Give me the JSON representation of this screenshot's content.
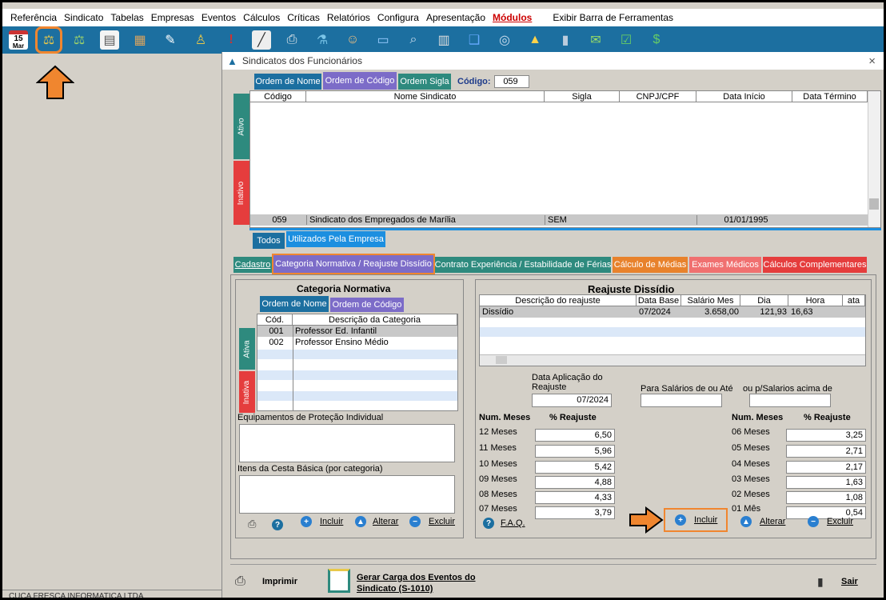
{
  "menu": [
    "Referência",
    "Sindicato",
    "Tabelas",
    "Empresas",
    "Eventos",
    "Cálculos",
    "Críticas",
    "Relatórios",
    "Configura",
    "Apresentação"
  ],
  "menu_modulos": "Módulos",
  "menu_barra": "Exibir Barra de Ferramentas",
  "calendar": {
    "day": "15",
    "month": "Mar"
  },
  "window": {
    "title": "Sindicatos dos Funcionários",
    "close": "×"
  },
  "order_tabs": {
    "nome": "Ordem de Nome",
    "codigo": "Ordem de Código",
    "sigla": "Ordem Sigla",
    "codigo_label": "Código:",
    "codigo_value": "059"
  },
  "sind_table": {
    "headers": [
      "Código",
      "Nome Sindicato",
      "Sigla",
      "CNPJ/CPF",
      "Data Início",
      "Data Término"
    ],
    "rows": [
      {
        "codigo": "059",
        "nome": "Sindicato dos Empregados de Marília",
        "sigla": "SEM",
        "cnpj": "",
        "inicio": "01/01/1995",
        "termino": ""
      }
    ]
  },
  "vtabs": {
    "ativo": "Ativo",
    "inativo": "Inativo"
  },
  "filter_tabs": {
    "todos": "Todos",
    "utilizados": "Utilizados Pela Empresa"
  },
  "main_tabs": [
    "Cadastro",
    "Categoria Normativa / Reajuste Dissídio",
    "Contrato Experiência / Estabilidade de Férias",
    "Cálculo de Médias",
    "Exames Médicos",
    "Cálculos Complementares"
  ],
  "categoria": {
    "title": "Categoria Normativa",
    "order_nome": "Ordem de Nome",
    "order_codigo": "Ordem de Código",
    "headers": [
      "Cód.",
      "Descrição da Categoria"
    ],
    "rows": [
      {
        "cod": "001",
        "desc": "Professor Ed. Infantil"
      },
      {
        "cod": "002",
        "desc": "Professor Ensino Médio"
      }
    ],
    "vtab_ativa": "Ativa",
    "vtab_inativa": "Inativa",
    "epi_label": "Equipamentos de Proteção Individual",
    "cesta_label": "Itens da Cesta Básica (por categoria)",
    "incluir": "Incluir",
    "alterar": "Alterar",
    "excluir": "Excluir"
  },
  "reajuste": {
    "title": "Reajuste Dissídio",
    "headers": [
      "Descrição do reajuste",
      "Data Base",
      "Salário Mes",
      "Dia",
      "Hora",
      "ata"
    ],
    "rows": [
      {
        "desc": "Dissídio",
        "base": "07/2024",
        "salario": "3.658,00",
        "dia": "121,93",
        "hora": "16,63"
      }
    ],
    "data_aplic_label": "Data Aplicação do Reajuste",
    "data_aplic_value": "07/2024",
    "para_salarios_label": "Para Salários de ou Até",
    "acima_label": "ou p/Salarios acima de",
    "num_meses": "Num. Meses",
    "pct_reajuste": "% Reajuste",
    "left": [
      {
        "m": "12 Meses",
        "v": "6,50"
      },
      {
        "m": "11 Meses",
        "v": "5,96"
      },
      {
        "m": "10 Meses",
        "v": "5,42"
      },
      {
        "m": "09 Meses",
        "v": "4,88"
      },
      {
        "m": "08 Meses",
        "v": "4,33"
      },
      {
        "m": "07 Meses",
        "v": "3,79"
      }
    ],
    "right": [
      {
        "m": "06 Meses",
        "v": "3,25"
      },
      {
        "m": "05 Meses",
        "v": "2,71"
      },
      {
        "m": "04 Meses",
        "v": "2,17"
      },
      {
        "m": "03 Meses",
        "v": "1,63"
      },
      {
        "m": "02 Meses",
        "v": "1,08"
      },
      {
        "m": "01 Mês",
        "v": "0,54"
      }
    ],
    "faq": "F.A.Q.",
    "incluir": "Incluir",
    "alterar": "Alterar",
    "excluir": "Excluir"
  },
  "bottom": {
    "imprimir": "Imprimir",
    "gerar": "Gerar Carga dos Eventos do Sindicato (S-1010)",
    "sair": "Sair"
  },
  "status": "CUCA FRESCA INFORMATICA LTDA"
}
